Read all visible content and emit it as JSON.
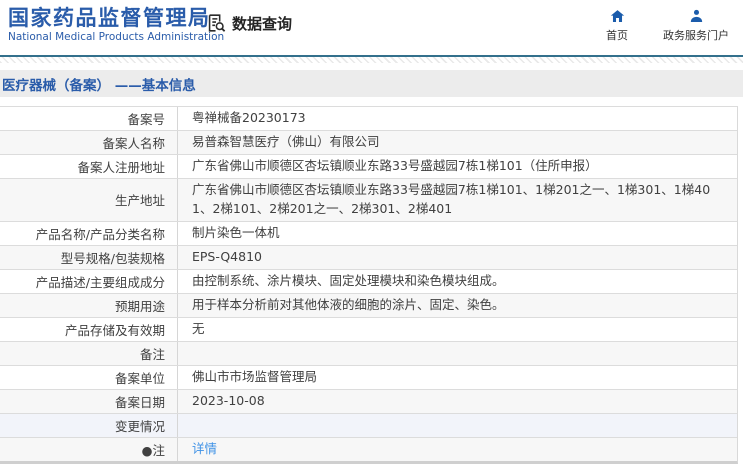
{
  "header": {
    "logo_title": "国家药品监督管理局",
    "logo_subtitle": "National Medical Products Administration",
    "query_label": "数据查询",
    "home_label": "首页",
    "portal_label": "政务服务门户",
    "icons": {
      "query": "document-magnifier-icon",
      "home": "house-icon",
      "portal": "person-icon"
    }
  },
  "page": {
    "title": "医疗器械（备案） ——基本信息"
  },
  "table": {
    "rows": [
      {
        "label": "备案号",
        "value": "粤禅械备20230173"
      },
      {
        "label": "备案人名称",
        "value": "易普森智慧医疗（佛山）有限公司"
      },
      {
        "label": "备案人注册地址",
        "value": "广东省佛山市顺德区杏坛镇顺业东路33号盛越园7栋1梯101（住所申报）"
      },
      {
        "label": "生产地址",
        "value": "广东省佛山市顺德区杏坛镇顺业东路33号盛越园7栋1梯101、1梯201之一、1梯301、1梯401、2梯101、2梯201之一、2梯301、2梯401"
      },
      {
        "label": "产品名称/产品分类名称",
        "value": "制片染色一体机"
      },
      {
        "label": "型号规格/包装规格",
        "value": "EPS-Q4810"
      },
      {
        "label": "产品描述/主要组成成分",
        "value": "由控制系统、涂片模块、固定处理模块和染色模块组成。"
      },
      {
        "label": "预期用途",
        "value": "用于样本分析前对其他体液的细胞的涂片、固定、染色。"
      },
      {
        "label": "产品存储及有效期",
        "value": "无"
      },
      {
        "label": "备注",
        "value": ""
      },
      {
        "label": "备案单位",
        "value": "佛山市市场监督管理局"
      },
      {
        "label": "备案日期",
        "value": "2023-10-08"
      },
      {
        "label": "变更情况",
        "value": "",
        "highlighted": true
      },
      {
        "label": "●注",
        "value": "详情",
        "link": true
      }
    ]
  },
  "colors": {
    "brand_blue": "#2a5caa",
    "icon_blue": "#1b5cab",
    "link_blue": "#3f92e6",
    "title_band_gray": "#ececec",
    "row_alt_gray": "#f7f7f7",
    "row_highlight_blue": "#f2f4fa",
    "header_rule": "#33708c"
  }
}
